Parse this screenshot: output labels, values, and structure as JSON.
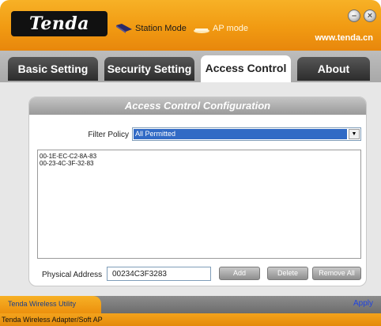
{
  "header": {
    "logo": "Tenda",
    "station_mode_label": "Station Mode",
    "ap_mode_label": "AP mode",
    "url": "www.tenda.cn"
  },
  "tabs": [
    {
      "label": "Basic Setting",
      "active": false
    },
    {
      "label": "Security Setting",
      "active": false
    },
    {
      "label": "Access Control",
      "active": true
    },
    {
      "label": "About",
      "active": false
    }
  ],
  "panel": {
    "title": "Access Control Configuration",
    "filter_policy_label": "Filter Policy",
    "filter_policy_value": "All Permitted",
    "mac_list": [
      "00-1E-EC-C2-8A-83",
      "00-23-4C-3F-32-83"
    ],
    "physical_address_label": "Physical Address",
    "physical_address_value": "00234C3F3283",
    "buttons": {
      "add": "Add",
      "delete": "Delete",
      "remove_all": "Remove All"
    }
  },
  "footer": {
    "utility_label": "Tenda Wireless Utility",
    "apply_label": "Apply",
    "status_text": "Tenda Wireless Adapter/Soft AP"
  },
  "colors": {
    "header_orange": "#f19a12",
    "tab_dark": "#2c2c2c",
    "selection_blue": "#316ac5",
    "apply_blue": "#1f43e0"
  }
}
